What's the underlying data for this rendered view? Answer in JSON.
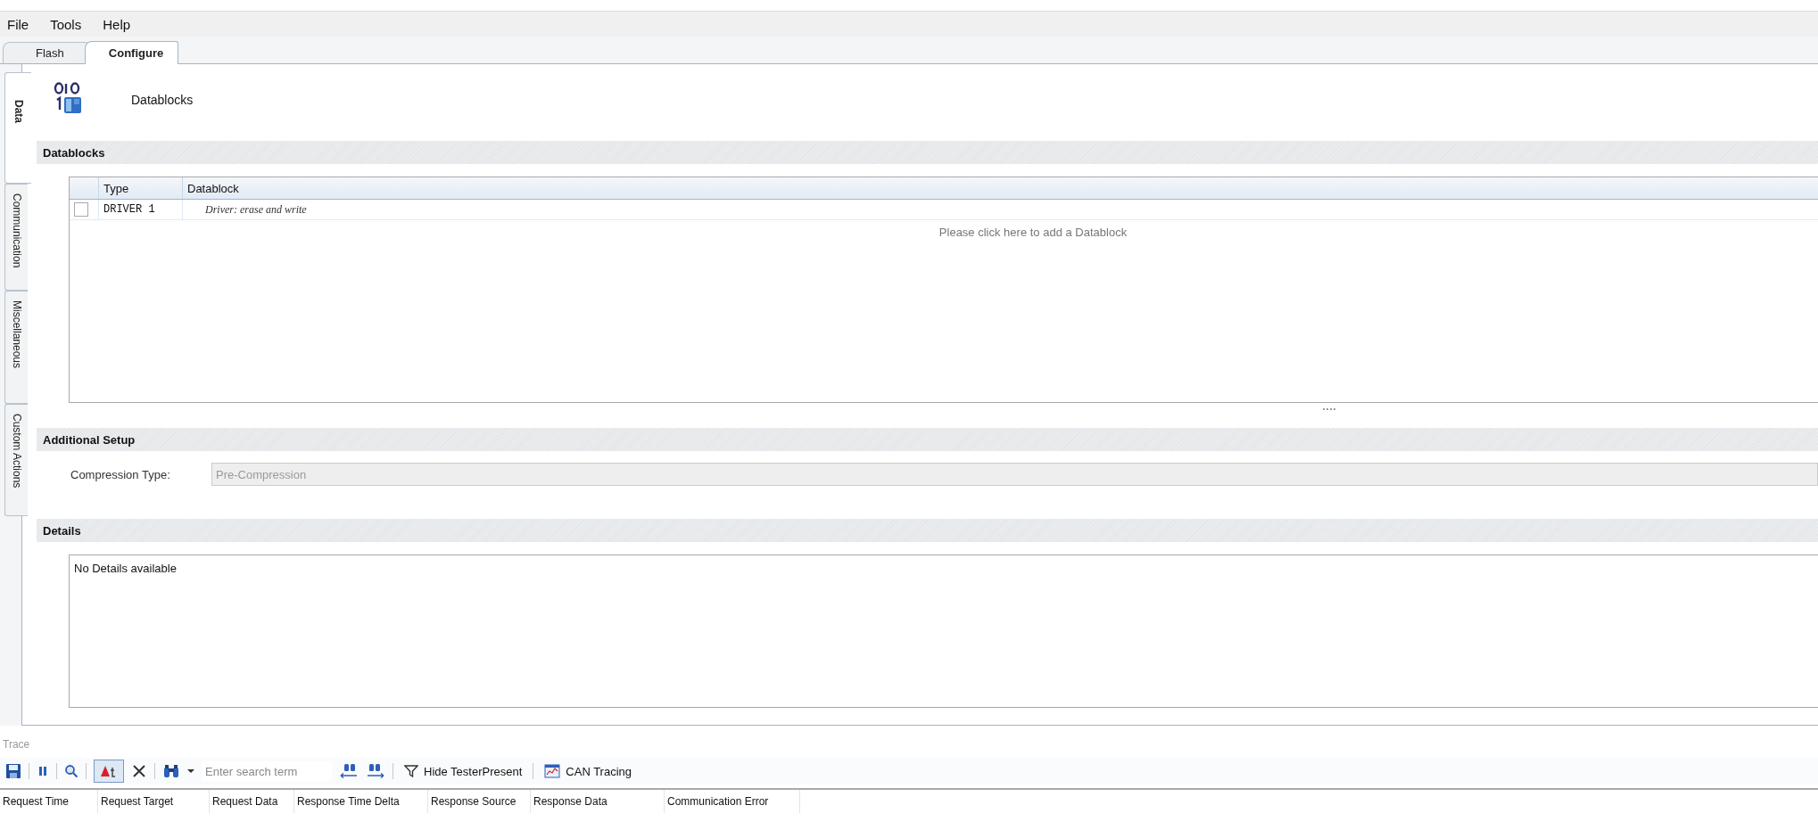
{
  "menu": [
    "File",
    "Tools",
    "Help"
  ],
  "tabs": [
    {
      "label": "Flash",
      "selected": false
    },
    {
      "label": "Configure",
      "selected": true
    }
  ],
  "side_tabs": [
    {
      "label": "Data",
      "selected": true
    },
    {
      "label": "Communication",
      "selected": false
    },
    {
      "label": "Miscellaneous",
      "selected": false
    },
    {
      "label": "Custom Actions",
      "selected": false
    }
  ],
  "page": {
    "title": "Datablocks"
  },
  "datablocks": {
    "header": "Datablocks",
    "columns": [
      "Type",
      "Datablock"
    ],
    "rows": [
      {
        "checked": false,
        "type": "DRIVER 1",
        "datablock": "Driver: erase and write"
      }
    ],
    "empty_hint": "Please click here to add a Datablock"
  },
  "additional_setup": {
    "header": "Additional Setup",
    "label": "Compression Type:",
    "value": "Pre-Compression",
    "disabled": true
  },
  "details": {
    "header": "Details",
    "text": "No Details available"
  },
  "trace": {
    "title": "Trace",
    "timestamp_toggle": {
      "pressed": true
    },
    "search_placeholder": "Enter search term",
    "hide_tester_present": "Hide TesterPresent",
    "can_tracing": "CAN Tracing",
    "columns": [
      "Request Time",
      "Request Target",
      "Request Data",
      "Response Time Delta",
      "Response Source",
      "Response Data",
      "Communication Error"
    ]
  }
}
